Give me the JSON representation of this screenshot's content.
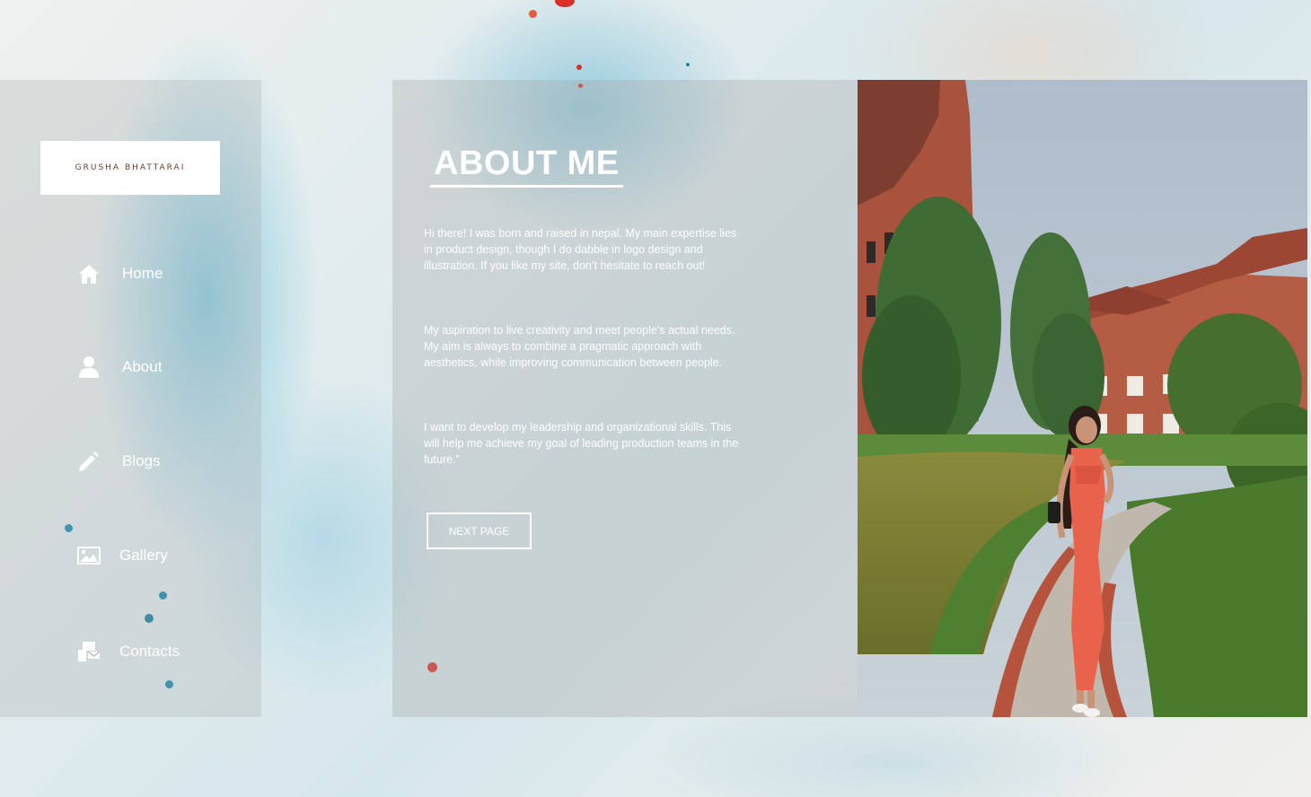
{
  "brand": {
    "logo_text": "GRUSHA BHATTARAI"
  },
  "nav": {
    "items": [
      {
        "label": "Home",
        "icon": "home-icon"
      },
      {
        "label": "About",
        "icon": "user-icon"
      },
      {
        "label": "Blogs",
        "icon": "pencil-icon"
      },
      {
        "label": "Gallery",
        "icon": "image-icon"
      },
      {
        "label": "Contacts",
        "icon": "contacts-icon"
      }
    ]
  },
  "about": {
    "title": "ABOUT ME",
    "paragraphs": [
      "Hi there! I was born and raised in nepal. My main expertise lies in product design, though I do dabble in logo design and illustration. If you like my site, don’t hesitate to reach out!",
      "My aspiration to live creativity and meet people’s actual needs. My aim is always to combine a pragmatic approach with aesthetics, while improving communication between people.",
      "I want to develop my leadership and organizational skills. This will help me achieve my goal of leading production teams in the future.”"
    ],
    "next_button": "NEXT PAGE"
  },
  "colors": {
    "logo_text": "#6b3b2e",
    "panel_overlay": "rgba(170,170,170,0.35)",
    "dress": "#e8624c",
    "brick": "#b5533c"
  }
}
